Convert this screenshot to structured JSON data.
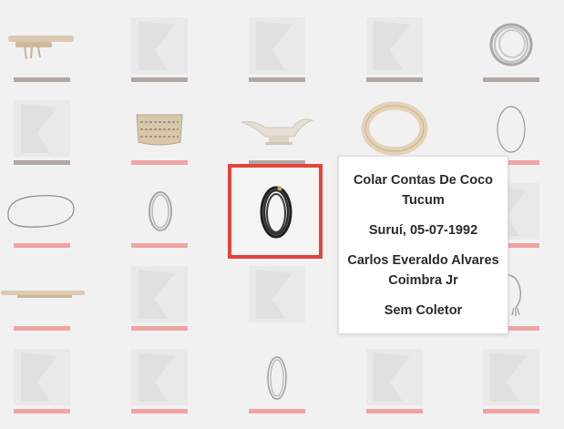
{
  "tooltip": {
    "title": "Colar Contas De Coco Tucum",
    "origin": "Suruí, 05-07-1992",
    "person": "Carlos Everaldo Alvares Coimbra Jr",
    "collector": "Sem Coletor"
  },
  "colors": {
    "bar_gray": "#b3a7a1",
    "bar_pink": "#f1a3a3",
    "highlight_border": "#e2453c",
    "placeholder": "#e9e9e9"
  },
  "grid": {
    "columns": 5,
    "rows": 5,
    "items": [
      {
        "thumb": "rolled-textile",
        "bar": "gray"
      },
      {
        "thumb": "placeholder",
        "bar": "gray"
      },
      {
        "thumb": "placeholder",
        "bar": "gray"
      },
      {
        "thumb": "placeholder",
        "bar": "gray"
      },
      {
        "thumb": "bead-necklace-bundle",
        "bar": "gray"
      },
      {
        "thumb": "placeholder",
        "bar": "gray"
      },
      {
        "thumb": "woven-basket",
        "bar": "pink"
      },
      {
        "thumb": "ceramic-boat-bowl",
        "bar": "gray"
      },
      {
        "thumb": "beaded-collar",
        "bar": "gray"
      },
      {
        "thumb": "thin-necklace",
        "bar": "pink"
      },
      {
        "thumb": "loop-necklace",
        "bar": "pink"
      },
      {
        "thumb": "coil-necklace",
        "bar": "pink"
      },
      {
        "thumb": "black-coconut-necklace",
        "bar": "none"
      },
      {
        "thumb": "placeholder",
        "bar": "none"
      },
      {
        "thumb": "placeholder",
        "bar": "pink"
      },
      {
        "thumb": "long-stick-ornament",
        "bar": "pink"
      },
      {
        "thumb": "placeholder",
        "bar": "pink"
      },
      {
        "thumb": "placeholder",
        "bar": "pink"
      },
      {
        "thumb": "placeholder",
        "bar": "none"
      },
      {
        "thumb": "hanging-ornament",
        "bar": "pink"
      },
      {
        "thumb": "placeholder",
        "bar": "pink"
      },
      {
        "thumb": "placeholder",
        "bar": "pink"
      },
      {
        "thumb": "silver-coil-necklace",
        "bar": "pink"
      },
      {
        "thumb": "placeholder",
        "bar": "pink"
      },
      {
        "thumb": "placeholder",
        "bar": "pink"
      }
    ]
  }
}
